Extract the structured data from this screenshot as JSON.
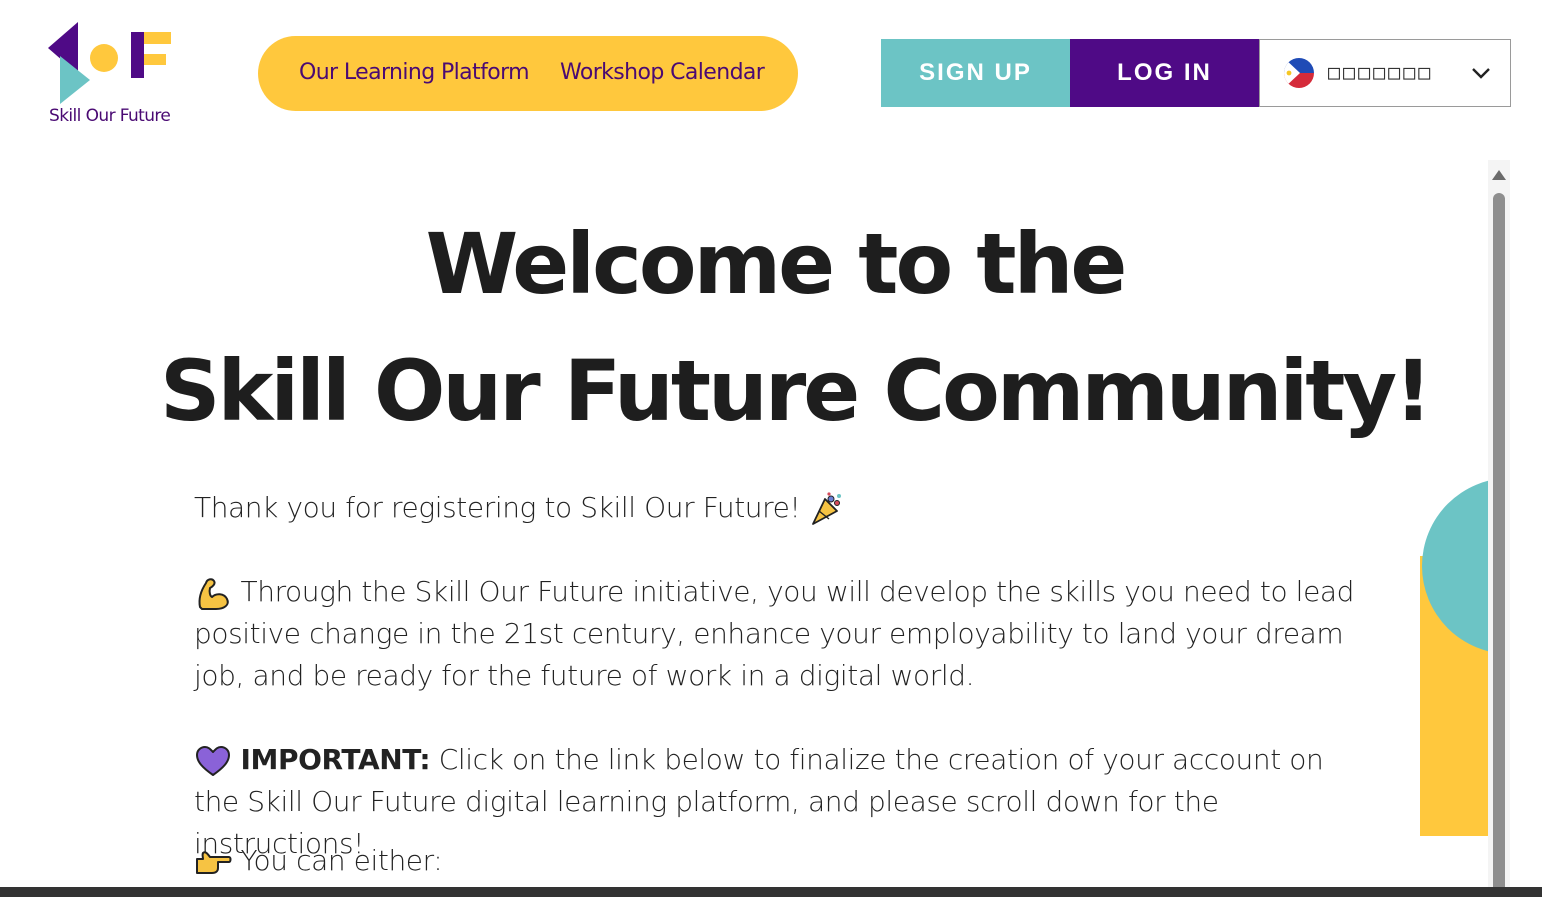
{
  "header": {
    "logo_text": "Skill Our Future",
    "nav": [
      "Our Learning Platform",
      "Workshop Calendar"
    ],
    "signup_label": "SIGN UP",
    "login_label": "LOG IN",
    "language_label": "□□□□□□□",
    "language_flag_icon": "philippines-flag-icon"
  },
  "hero": {
    "title_line1": "Welcome to the",
    "title_line2": "Skill Our Future Community!"
  },
  "body": {
    "thank_you": "Thank you for registering to Skill Our Future! ",
    "initiative": "Through the Skill Our Future initiative, you will develop the skills you need to lead positive change in the 21st century, enhance your employability to land your dream job, and be ready for the future of work in a digital world.",
    "important_label": "IMPORTANT:",
    "important_text": " Click on the link below to finalize the creation of your account on the Skill Our Future digital learning platform, and please scroll down for the instructions!",
    "either": "You can either:"
  },
  "icons": {
    "party": "party-popper-icon",
    "muscle": "flexed-biceps-icon",
    "heart": "purple-heart-icon",
    "point": "pointing-hand-icon"
  },
  "colors": {
    "brand_purple": "#4f0a86",
    "brand_yellow": "#ffc83d",
    "brand_teal": "#6cc4c5",
    "text_dark": "#1e1e1e"
  }
}
